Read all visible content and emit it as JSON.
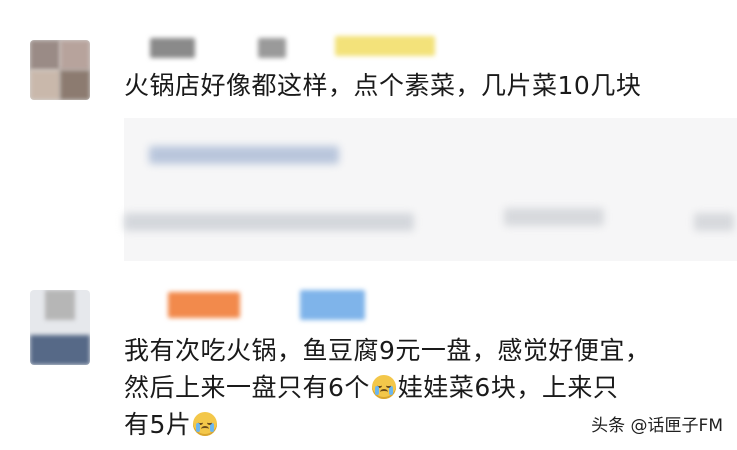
{
  "comments": [
    {
      "text": "火锅店好像都这样，点个素菜，几片菜10几块"
    },
    {
      "text_line1": "我有次吃火锅，鱼豆腐9元一盘，感觉好便宜，",
      "text_line2_a": "然后上来一盘只有6个",
      "text_line2_b": "娃娃菜6块，上来只",
      "text_line3": "有5片",
      "emoji_name": "crying-face-icon"
    }
  ],
  "watermark": {
    "text": "头条 @话匣子FM"
  },
  "colors": {
    "background": "#ffffff",
    "quote_card": "#f6f6f7",
    "text": "#1a1a1a"
  }
}
